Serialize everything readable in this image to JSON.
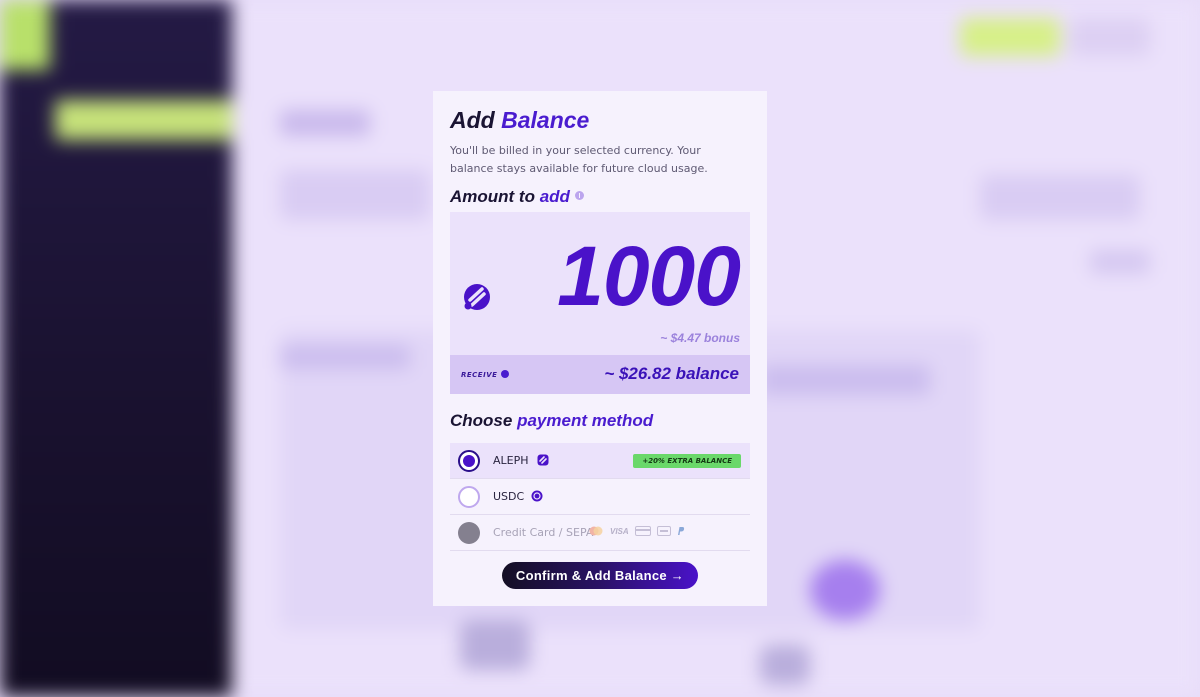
{
  "modal": {
    "title_part1": "Add",
    "title_part2": "Balance",
    "subtitle": "You'll be billed in your selected currency. Your balance stays available for future cloud usage.",
    "amount_heading_part1": "Amount to",
    "amount_heading_part2": "add",
    "amount_value": "1000",
    "bonus_text": "~ $4.47 bonus",
    "receive_label": "RECEIVE",
    "receive_value": "~ $26.82 balance",
    "payment_heading_part1": "Choose",
    "payment_heading_part2": "payment method",
    "methods": [
      {
        "label": "ALEPH",
        "badge": "+20% EXTRA BALANCE",
        "selected": true
      },
      {
        "label": "USDC",
        "selected": false
      },
      {
        "label": "Credit Card / SEPA",
        "disabled": true,
        "logos": [
          "VISA"
        ]
      }
    ],
    "confirm_label": "Confirm & Add Balance →"
  },
  "colors": {
    "accent": "#4a1ccf",
    "badge_green": "#6ad86a",
    "modal_bg": "#f6f2fd"
  },
  "icons": {
    "aleph_token": "aleph-token-icon",
    "usdc_token": "usdc-icon",
    "info": "info-icon"
  }
}
